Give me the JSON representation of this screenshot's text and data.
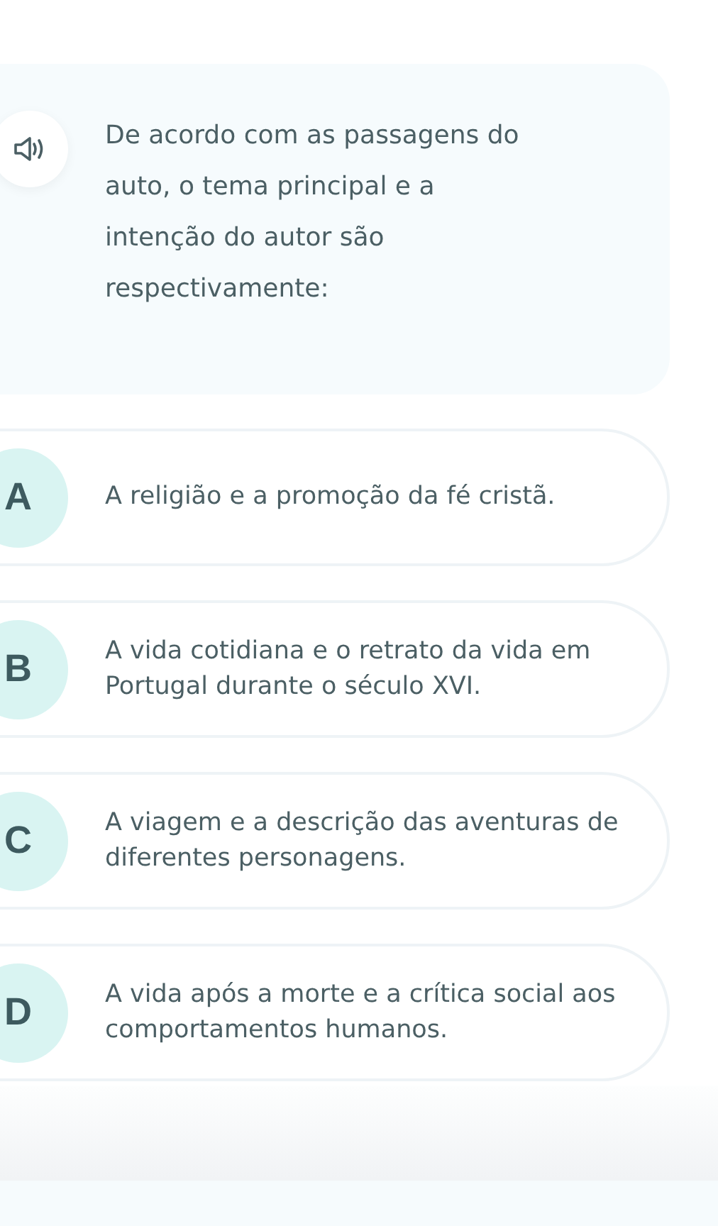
{
  "question": {
    "text": "De acordo com as passagens do auto, o tema principal e a intenção do autor são respectivamente:"
  },
  "options": [
    {
      "letter": "A",
      "text": "A religião e a promoção da fé cristã."
    },
    {
      "letter": "B",
      "text": "A vida cotidiana e o retrato da vida em Portugal durante o século XVI."
    },
    {
      "letter": "C",
      "text": "A viagem e a descrição das aventuras de diferentes personagens."
    },
    {
      "letter": "D",
      "text": "A vida após a morte e a crítica social aos comportamentos humanos."
    }
  ]
}
